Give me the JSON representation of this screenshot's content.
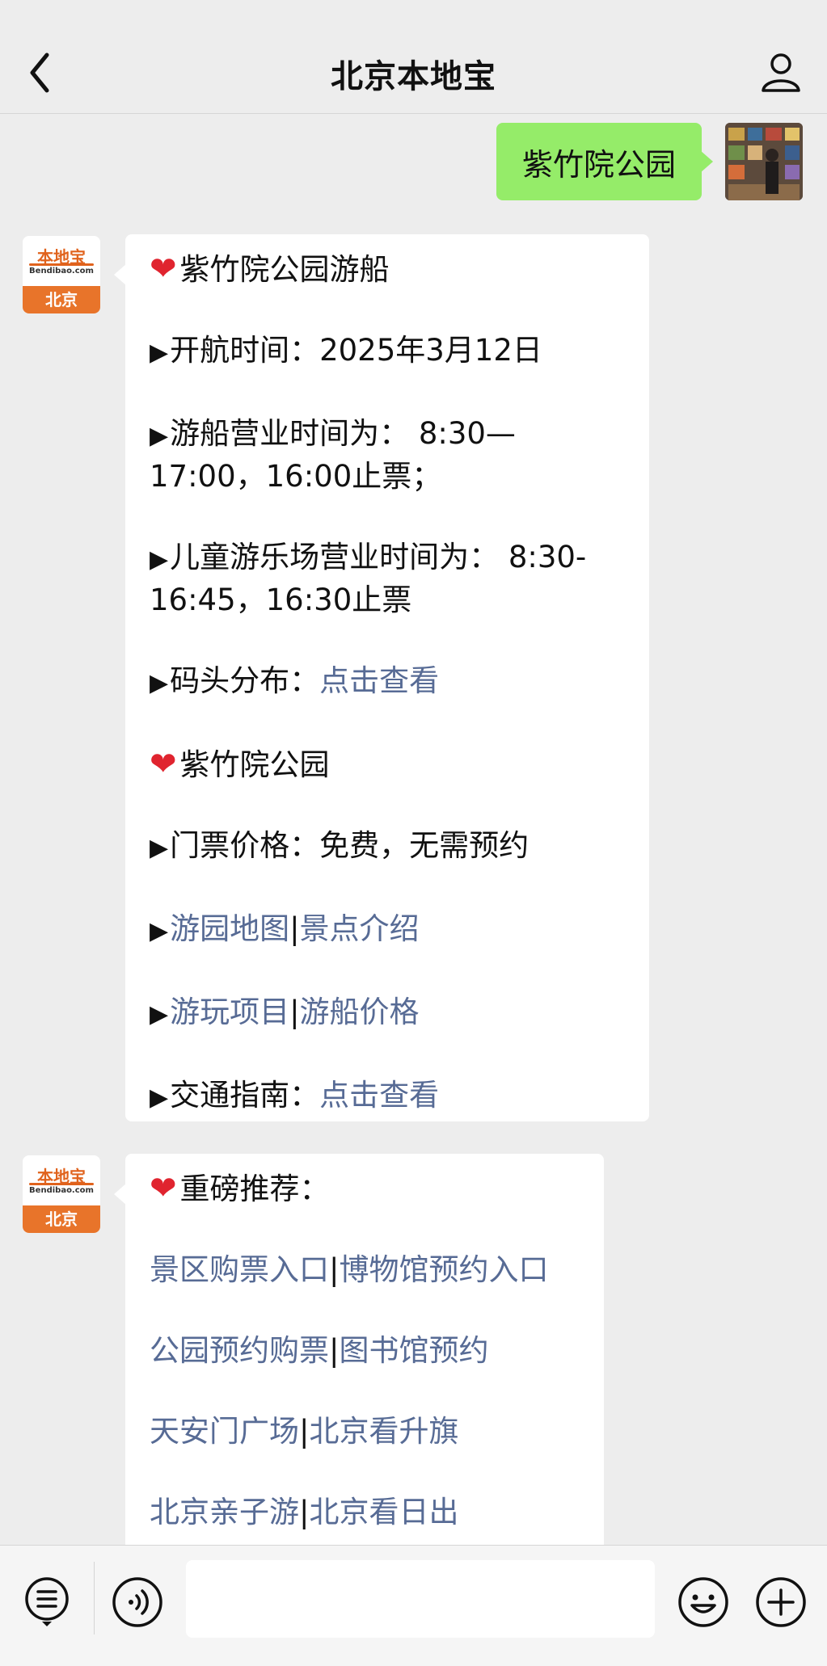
{
  "header": {
    "title": "北京本地宝"
  },
  "outgoing": {
    "text": "紫竹院公园"
  },
  "avatar": {
    "brand": "本地宝",
    "site": "Bendibao.com",
    "city": "北京"
  },
  "message1": {
    "heading1": "紫竹院公园游船",
    "open_label": "开航时间：",
    "open_date": "2025年3月12日",
    "boat_hours": "游船营业时间为： 8:30—17:00，16:00止票；",
    "kids_hours": "儿童游乐场营业时间为： 8:30-16:45，16:30止票",
    "dock_label": "码头分布：",
    "dock_link": "点击查看",
    "heading2": "紫竹院公园",
    "ticket": "门票价格：免费，无需预约",
    "map_link": "游园地图",
    "sight_link": "景点介绍",
    "play_link": "游玩项目",
    "boatprice_link": "游船价格",
    "traffic_label": "交通指南：",
    "traffic_link": "点击查看",
    "sep": "|"
  },
  "message2": {
    "heading": "重磅推荐：",
    "rows": [
      [
        "景区购票入口",
        "博物馆预约入口"
      ],
      [
        "公园预约购票",
        "图书馆预约"
      ],
      [
        "天安门广场",
        "北京看升旗"
      ],
      [
        "北京亲子游",
        "北京看日出"
      ]
    ]
  },
  "colors": {
    "link": "#576b95",
    "outgoing_bubble": "#95ec69",
    "heart": "#e0242f",
    "brand_orange": "#e8742a"
  },
  "icons": [
    "back-chevron-icon",
    "user-icon",
    "heart-icon",
    "triangle-bullet-icon",
    "menu-list-icon",
    "voice-icon",
    "emoji-icon",
    "plus-icon"
  ]
}
